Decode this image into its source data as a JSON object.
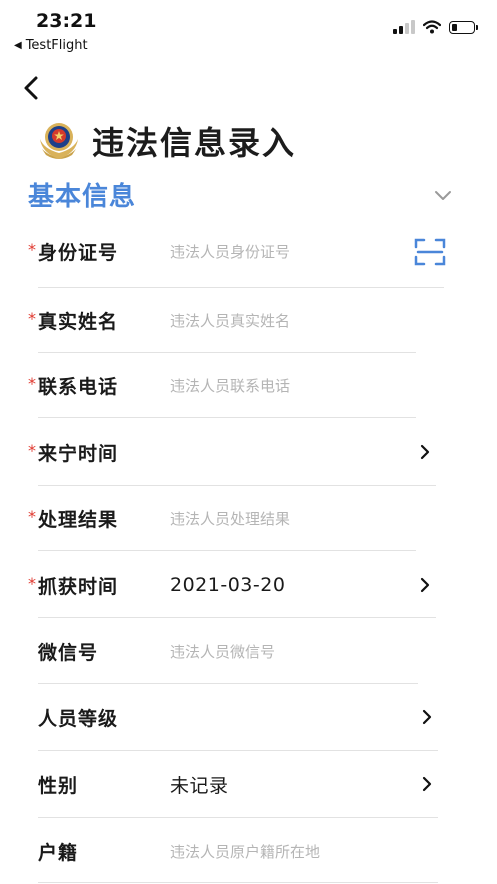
{
  "status_bar": {
    "time": "23:21",
    "back_app": "TestFlight"
  },
  "header": {
    "title": "违法信息录入"
  },
  "section": {
    "title": "基本信息"
  },
  "colors": {
    "accent": "#4a86d9",
    "required": "#e0392f",
    "placeholder": "#b5b5b5"
  },
  "form": {
    "id_number": {
      "label": "身份证号",
      "placeholder": "违法人员身份证号",
      "required": true
    },
    "real_name": {
      "label": "真实姓名",
      "placeholder": "违法人员真实姓名",
      "required": true
    },
    "phone": {
      "label": "联系电话",
      "placeholder": "违法人员联系电话",
      "required": true
    },
    "arrival_time": {
      "label": "来宁时间",
      "value": "",
      "required": true
    },
    "result": {
      "label": "处理结果",
      "placeholder": "违法人员处理结果",
      "required": true
    },
    "capture_time": {
      "label": "抓获时间",
      "value": "2021-03-20",
      "required": true
    },
    "wechat": {
      "label": "微信号",
      "placeholder": "违法人员微信号",
      "required": false
    },
    "level": {
      "label": "人员等级",
      "value": "",
      "required": false
    },
    "gender": {
      "label": "性别",
      "value": "未记录",
      "required": false
    },
    "household": {
      "label": "户籍",
      "placeholder": "违法人员原户籍所在地",
      "required": false
    }
  }
}
